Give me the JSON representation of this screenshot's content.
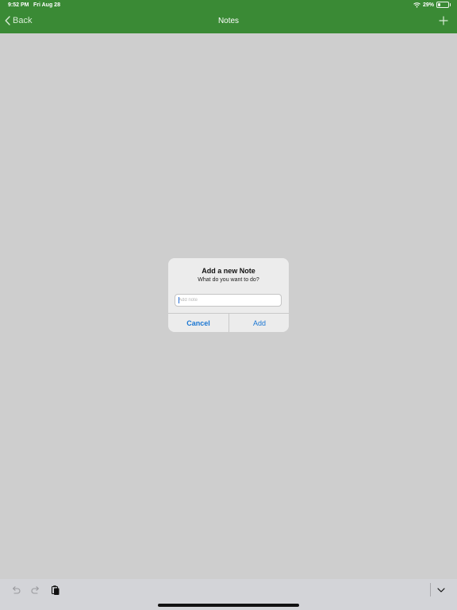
{
  "status": {
    "time": "9:52 PM",
    "date": "Fri Aug 28",
    "battery": "29%"
  },
  "navbar": {
    "back_label": "Back",
    "title": "Notes"
  },
  "dialog": {
    "title": "Add a new Note",
    "message": "What do you want to do?",
    "input_placeholder": "Add note",
    "input_value": "",
    "cancel_label": "Cancel",
    "add_label": "Add"
  },
  "colors": {
    "header": "#3a8a35",
    "background": "#cecece",
    "accent": "#1a76d2"
  },
  "icons": {
    "back": "chevron-left-icon",
    "add": "plus-icon",
    "undo": "undo-icon",
    "redo": "redo-icon",
    "paste": "paste-icon",
    "dismiss": "chevron-down-icon"
  }
}
